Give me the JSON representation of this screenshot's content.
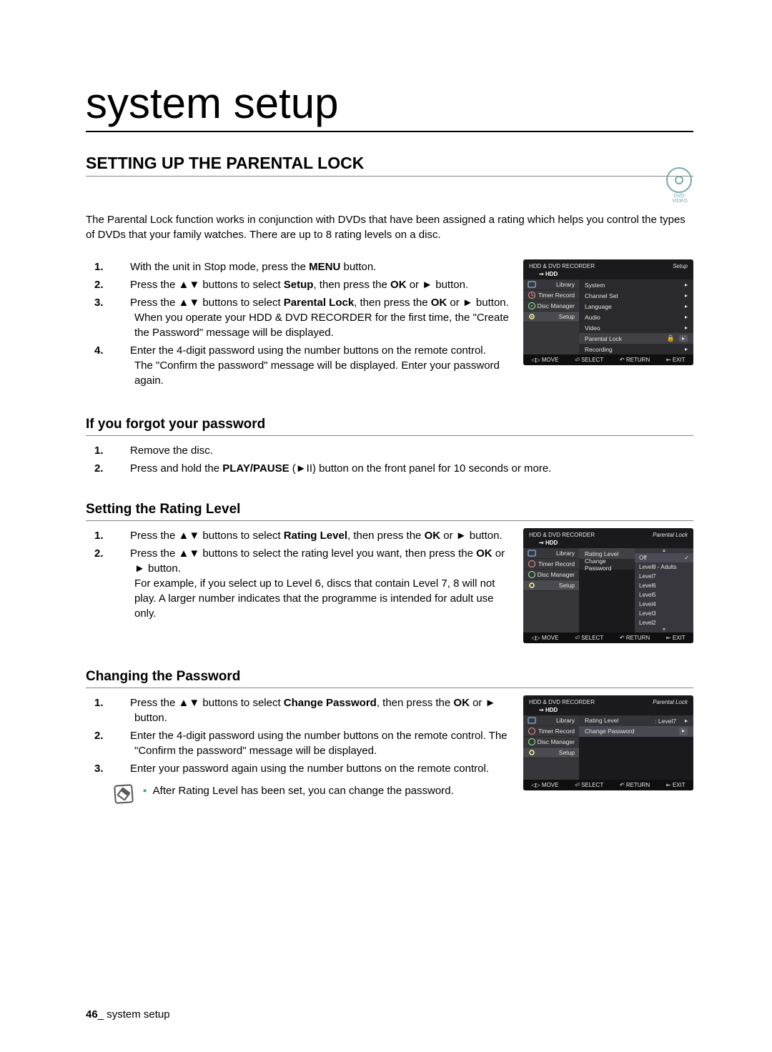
{
  "page": {
    "title": "system setup",
    "h1": "SETTING UP THE PARENTAL LOCK",
    "intro": "The Parental Lock function works in conjunction with DVDs that have been assigned a rating which helps you control the types of DVDs that your family watches. There are up to 8 rating levels on a disc.",
    "dvd_badge": "DVD-VIDEO",
    "footer_num": "46",
    "footer_sep": "_",
    "footer_text": " system setup"
  },
  "steps_main": {
    "s1a": "With the unit in Stop mode, press the ",
    "s1b": "MENU",
    "s1c": " button.",
    "s2a": "Press the ▲▼ buttons to select ",
    "s2b": "Setup",
    "s2c": ", then press the ",
    "s2d": "OK",
    "s2e": " or ► button.",
    "s3a": "Press the ▲▼ buttons to select ",
    "s3b": "Parental Lock",
    "s3c": ", then press the ",
    "s3d": "OK",
    "s3e": " or ► button.",
    "s3f": "When you operate your HDD & DVD RECORDER for the first time, the \"Create the Password\" message will be displayed.",
    "s4a": "Enter the 4-digit password using the number buttons on the remote control.",
    "s4b": "The \"Confirm the password\" message will be displayed. Enter your password again."
  },
  "forgot": {
    "heading": "If you forgot your password",
    "s1": "Remove the disc.",
    "s2a": "Press and hold the ",
    "s2b": "PLAY/PAUSE",
    "s2c": " (►II",
    "s2d": ") button on the front panel for 10 seconds or more."
  },
  "rating": {
    "heading": "Setting the Rating Level",
    "s1a": "Press the ▲▼ buttons to select ",
    "s1b": "Rating Level",
    "s1c": ", then press the ",
    "s1d": "OK",
    "s1e": " or ► button.",
    "s2a": "Press the ▲▼ buttons to select the rating level you want, then press the ",
    "s2b": "OK",
    "s2c": " or ► button.",
    "s2d": "For example, if you select up to Level 6, discs that contain Level 7, 8 will not play. A larger number indicates that the programme is intended for adult use only."
  },
  "change": {
    "heading": "Changing the Password",
    "s1a": "Press the ▲▼ buttons to select ",
    "s1b": "Change Password",
    "s1c": ", then press the ",
    "s1d": "OK",
    "s1e": " or ► button.",
    "s2": "Enter the 4-digit password using the number buttons on the remote control. The \"Confirm the password\" message will be displayed.",
    "s3": "Enter your password again using the number buttons on the remote control.",
    "note_bullet": "▪",
    "note": "After Rating Level has been set, you can change the password."
  },
  "osd": {
    "title": "HDD & DVD RECORDER",
    "crumb_hdd": "HDD",
    "mode_setup": "Setup",
    "mode_parental": "Parental Lock",
    "nav": [
      "Library",
      "Timer Record",
      "Disc Manager",
      "Setup"
    ],
    "menu1": [
      "System",
      "Channel Set",
      "Language",
      "Audio",
      "Video",
      "Parental Lock",
      "Recording"
    ],
    "menu2_left": [
      "Rating Level",
      "Change Password"
    ],
    "menu2_opts": [
      "Off",
      "Level8 - Adults",
      "Level7",
      "Level6",
      "Level5",
      "Level4",
      "Level3",
      "Level2"
    ],
    "menu3_rating": "Rating Level",
    "menu3_val": ": Level7",
    "menu3_change": "Change Password",
    "foot": {
      "move": "MOVE",
      "select": "SELECT",
      "return": "RETURN",
      "exit": "EXIT"
    }
  }
}
